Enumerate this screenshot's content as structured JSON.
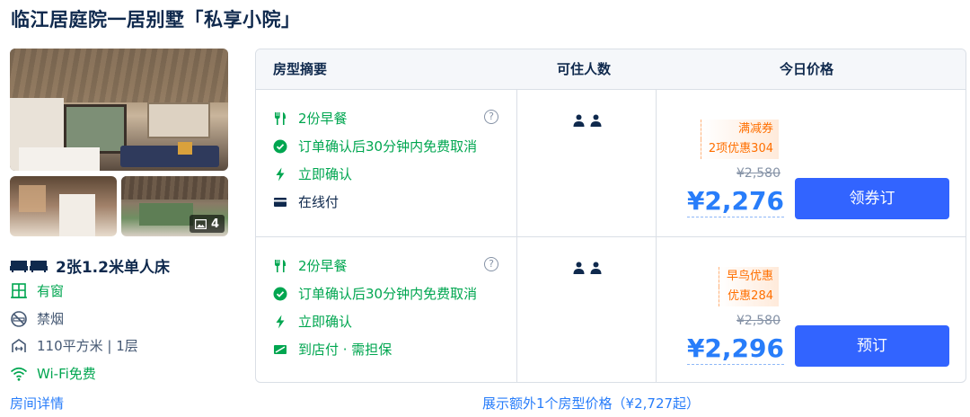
{
  "title": "临江居庭院一居别墅「私享小院」",
  "photos": {
    "count": "4"
  },
  "room": {
    "bed": "2张1.2米单人床",
    "window": "有窗",
    "smoking": "禁烟",
    "area": "110平方米 | 1层",
    "wifi": "Wi-Fi免费",
    "details_link": "房间详情"
  },
  "table": {
    "headers": {
      "summary": "房型摘要",
      "capacity": "可住人数",
      "price": "今日价格"
    },
    "offers": [
      {
        "breakfast": "2份早餐",
        "help": "?",
        "cancel": "订单确认后30分钟内免费取消",
        "confirm": "立即确认",
        "payment": "在线付",
        "promo_line1": "满减券",
        "promo_line2": "2项优惠304",
        "original_price": "¥2,580",
        "price": "¥2,276",
        "button": "领券订"
      },
      {
        "breakfast": "2份早餐",
        "help": "?",
        "cancel": "订单确认后30分钟内免费取消",
        "confirm": "立即确认",
        "payment": "到店付 · 需担保",
        "promo_line1": "早鸟优惠",
        "promo_line2": "优惠284",
        "original_price": "¥2,580",
        "price": "¥2,296",
        "button": "预订"
      }
    ]
  },
  "more_link": "展示额外1个房型价格（¥2,727起）",
  "colors": {
    "green": "#00a650",
    "blue": "#287dfa",
    "button": "#3264ff",
    "orange": "#ff6f00",
    "text": "#0f294d"
  }
}
